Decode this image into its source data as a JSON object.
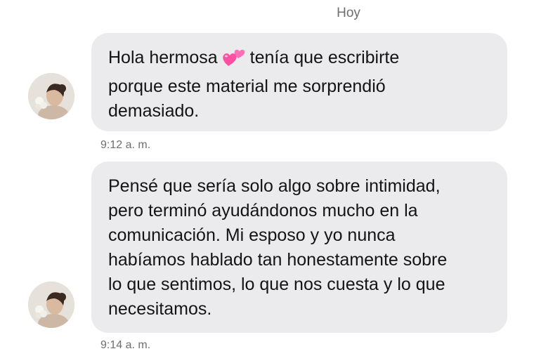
{
  "day_label": "Hoy",
  "messages": [
    {
      "text_before": "Hola hermosa",
      "emoji": "two-hearts-emoji",
      "text_after": "tenía que escribirte\nporque este material me sorprendió\ndemasiado.",
      "time": "9:12 a. m."
    },
    {
      "text": "Pensé que sería solo algo sobre intimidad,\npero terminó ayudándonos mucho en la\ncomunicación. Mi esposo y yo nunca\nhabíamos hablado tan honestamente sobre\nlo que sentimos, lo que nos cuesta y lo que\nnecesitamos.",
      "time": "9:14 a. m."
    }
  ],
  "colors": {
    "bubble": "#ebebed",
    "text": "#141414",
    "meta_text": "#6e6e73",
    "heart_emoji": "#ff4fa3"
  }
}
